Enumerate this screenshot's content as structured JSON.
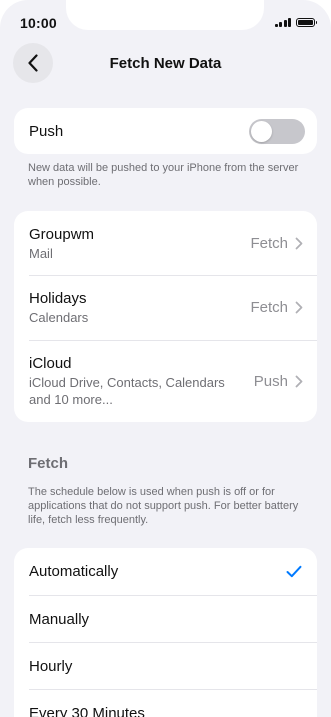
{
  "status": {
    "time": "10:00"
  },
  "nav": {
    "title": "Fetch New Data"
  },
  "push": {
    "label": "Push",
    "enabled": false,
    "note": "New data will be pushed to your iPhone from the server when possible."
  },
  "accounts": [
    {
      "name": "Groupwm",
      "detail": "Mail",
      "value": "Fetch"
    },
    {
      "name": "Holidays",
      "detail": "Calendars",
      "value": "Fetch"
    },
    {
      "name": "iCloud",
      "detail": "iCloud Drive, Contacts, Calendars and 10 more...",
      "value": "Push"
    }
  ],
  "fetch": {
    "header": "Fetch",
    "note": "The schedule below is used when push is off or for applications that do not support push. For better battery life, fetch less frequently.",
    "options": [
      {
        "label": "Automatically",
        "selected": true
      },
      {
        "label": "Manually",
        "selected": false
      },
      {
        "label": "Hourly",
        "selected": false
      },
      {
        "label": "Every 30 Minutes",
        "selected": false
      }
    ]
  },
  "colors": {
    "accent": "#007aff",
    "background": "#f2f2f7",
    "toggle_off": "#c7c7cc"
  }
}
